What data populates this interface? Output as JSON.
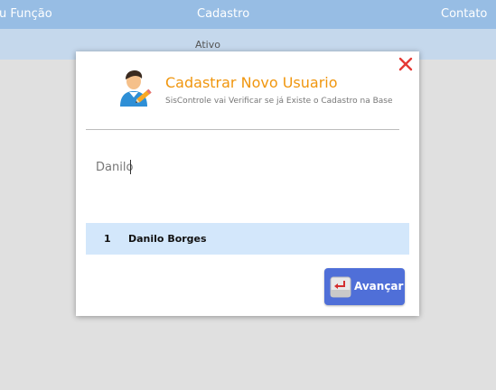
{
  "nav": {
    "item_1": "u Função",
    "item_2": "Cadastro",
    "item_3": "Contato"
  },
  "subbar": {
    "label": "Ativo"
  },
  "modal": {
    "title": "Cadastrar Novo Usuario",
    "subtitle": "SisControle vai Verificar se já Existe o Cadastro na Base",
    "search_value": "Danilo",
    "results": [
      {
        "index": "1",
        "name": "Danilo Borges"
      }
    ],
    "next_label": "Avançar",
    "close_icon": "close-icon",
    "avatar_icon": "user-edit-icon",
    "next_icon": "enter-key-icon"
  },
  "colors": {
    "nav_bg": "#97bde4",
    "title": "#f0960e",
    "result_bg": "#d3e7fb",
    "button_bg": "#4f6fd8",
    "close": "#e53935"
  }
}
